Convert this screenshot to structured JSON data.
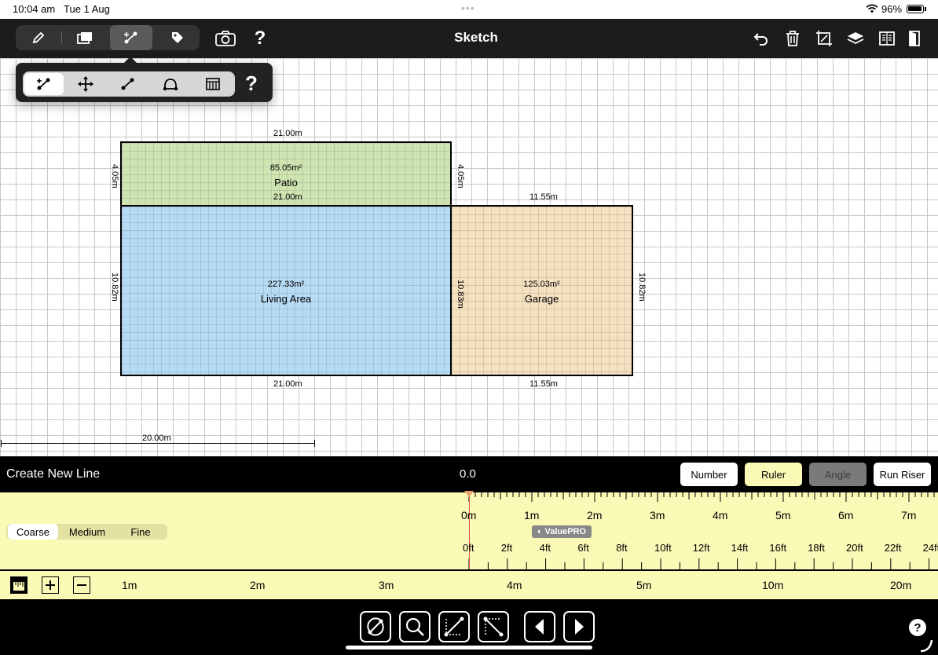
{
  "status": {
    "time": "10:04 am",
    "date": "Tue 1 Aug",
    "battery": "96%"
  },
  "toolbar": {
    "title": "Sketch",
    "left_tools": [
      "pencil-icon",
      "rooms-icon",
      "line-tool-icon",
      "tag-icon"
    ],
    "selected_tool": "line-tool-icon",
    "camera": "camera-icon",
    "help": "?",
    "right_tools": [
      "undo-icon",
      "trash-icon",
      "transform-icon",
      "layers-icon",
      "report-icon",
      "exit-icon"
    ]
  },
  "subtools": {
    "items": [
      "line-draw-icon",
      "move-icon",
      "split-line-icon",
      "curve-icon",
      "stairs-icon"
    ],
    "selected": "line-draw-icon",
    "help": "?"
  },
  "rooms": [
    {
      "name": "Patio",
      "area": "85.05m²",
      "color": "#cfe5b1"
    },
    {
      "name": "Living Area",
      "area": "227.33m²",
      "color": "#b6dcf5"
    },
    {
      "name": "Garage",
      "area": "125.03m²",
      "color": "#f5e1bf"
    }
  ],
  "dimensions": {
    "patio_top": "21.00m",
    "patio_left": "4.05m",
    "patio_right": "4.05m",
    "living_top": "21.00m",
    "living_left": "10.82m",
    "living_bottom": "21.00m",
    "shared_wall": "10.83m",
    "garage_top": "11.55m",
    "garage_right": "10.82m",
    "garage_bottom": "11.55m",
    "scale_bar": "20.00m"
  },
  "command": {
    "title": "Create New Line",
    "value": "0.0",
    "modes": [
      {
        "label": "Number",
        "state": "normal"
      },
      {
        "label": "Ruler",
        "state": "active"
      },
      {
        "label": "Angle",
        "state": "disabled"
      },
      {
        "label": "Run Riser",
        "state": "normal"
      }
    ]
  },
  "ruler": {
    "precision": [
      "Coarse",
      "Medium",
      "Fine"
    ],
    "selected_precision": "Coarse",
    "metric_labels": [
      "0m",
      "1m",
      "2m",
      "3m",
      "4m",
      "5m",
      "6m",
      "7m"
    ],
    "imperial_labels": [
      "0ft",
      "2ft",
      "4ft",
      "6ft",
      "8ft",
      "10ft",
      "12ft",
      "14ft",
      "16ft",
      "18ft",
      "20ft",
      "22ft",
      "24ft"
    ],
    "brand": "ValuePRO"
  },
  "zoom": {
    "labels": [
      "1m",
      "2m",
      "3m",
      "4m",
      "5m",
      "10m",
      "20m"
    ]
  },
  "bottom": {
    "tools": [
      "rotate-icon",
      "zoom-icon",
      "select-line-icon",
      "diagonal-icon",
      "previous-icon",
      "next-icon"
    ],
    "help": "?"
  }
}
